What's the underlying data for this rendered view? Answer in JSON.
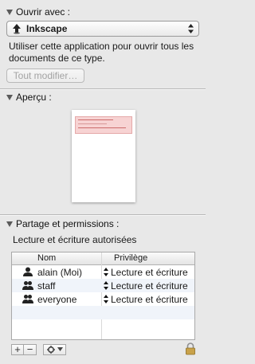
{
  "open_with": {
    "header": "Ouvrir avec :",
    "app_name": "Inkscape",
    "description": "Utiliser cette application pour ouvrir tous les documents de ce type.",
    "change_all_button": "Tout modifier…"
  },
  "preview": {
    "header": "Aperçu :"
  },
  "sharing": {
    "header": "Partage et permissions :",
    "summary": "Lecture et écriture autorisées",
    "columns": {
      "name": "Nom",
      "privilege": "Privilège"
    },
    "rows": [
      {
        "name": "alain (Moi)",
        "privilege": "Lecture et écriture",
        "icon": "single-user-icon"
      },
      {
        "name": "staff",
        "privilege": "Lecture et écriture",
        "icon": "group-icon"
      },
      {
        "name": "everyone",
        "privilege": "Lecture et écriture",
        "icon": "group-icon"
      }
    ],
    "add_label": "+",
    "remove_label": "−"
  }
}
